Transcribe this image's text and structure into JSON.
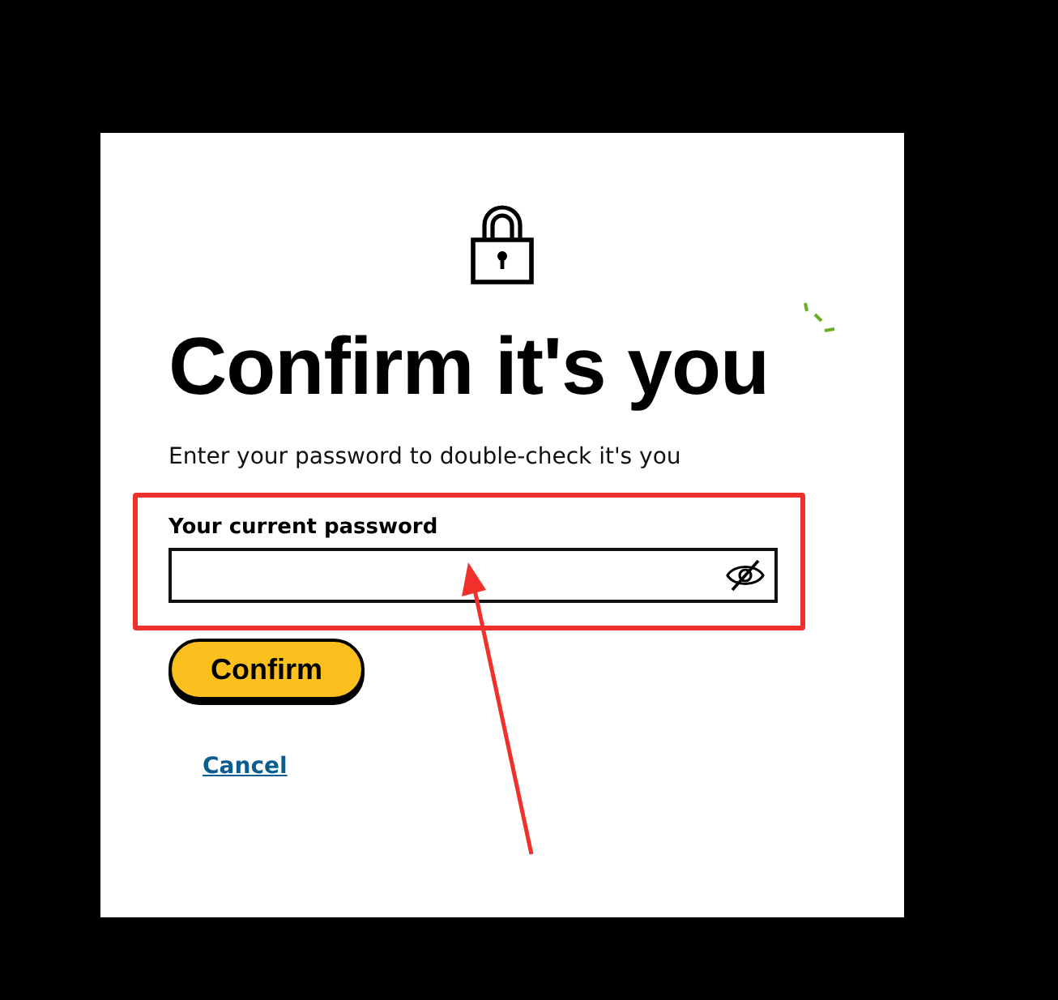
{
  "dialog": {
    "title": "Confirm it's you",
    "subtitle": "Enter your password to double-check it's you",
    "password_field": {
      "label": "Your current password",
      "revealed": false
    },
    "confirm_button": "Confirm",
    "cancel_link": "Cancel"
  }
}
